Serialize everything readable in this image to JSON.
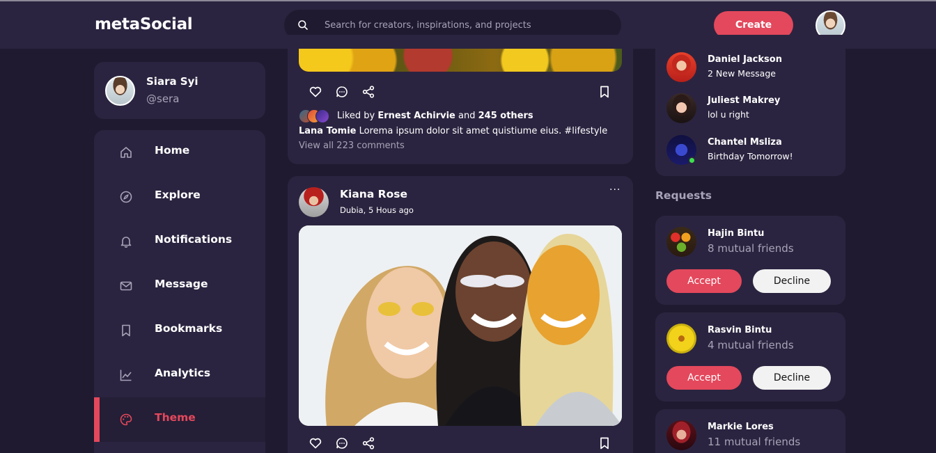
{
  "navbar": {
    "logo": "metaSocial",
    "search_placeholder": "Search for creators, inspirations, and projects",
    "create_label": "Create"
  },
  "profile": {
    "name": "Siara Syi",
    "handle": "@sera"
  },
  "sidebar": {
    "items": [
      {
        "label": "Home",
        "icon": "home-icon"
      },
      {
        "label": "Explore",
        "icon": "compass-icon"
      },
      {
        "label": "Notifications",
        "icon": "bell-icon"
      },
      {
        "label": "Message",
        "icon": "envelope-icon"
      },
      {
        "label": "Bookmarks",
        "icon": "bookmark-icon"
      },
      {
        "label": "Analytics",
        "icon": "chart-line-icon"
      },
      {
        "label": "Theme",
        "icon": "palette-icon",
        "active": true
      }
    ]
  },
  "feed": {
    "post1": {
      "liked_prefix": "Liked by",
      "liked_name": "Ernest Achirvie",
      "liked_and": "and",
      "liked_others": "245 others",
      "caption_user": "Lana Tomie",
      "caption_text": "Lorema ipsum dolor sit amet quistiume eius. #lifestyle",
      "view_comments": "View all 223 comments"
    },
    "post2": {
      "name": "Kiana Rose",
      "meta": "Dubia, 5 Hous ago",
      "more": "···"
    }
  },
  "messages": [
    {
      "name": "Daniel Jackson",
      "text": "2 New Message"
    },
    {
      "name": "Juliest Makrey",
      "text": "lol u right"
    },
    {
      "name": "Chantel Msliza",
      "text": "Birthday Tomorrow!",
      "online": true
    }
  ],
  "requests": {
    "heading": "Requests",
    "items": [
      {
        "name": "Hajin Bintu",
        "mutual": "8 mutual friends",
        "accept": "Accept",
        "decline": "Decline"
      },
      {
        "name": "Rasvin Bintu",
        "mutual": "4 mutual friends",
        "accept": "Accept",
        "decline": "Decline"
      },
      {
        "name": "Markie Lores",
        "mutual": "11 mutual friends"
      }
    ]
  },
  "colors": {
    "accent": "#e4485c",
    "surface": "#2b2440",
    "background": "#1f1a30",
    "muted": "#a8a3b8"
  }
}
